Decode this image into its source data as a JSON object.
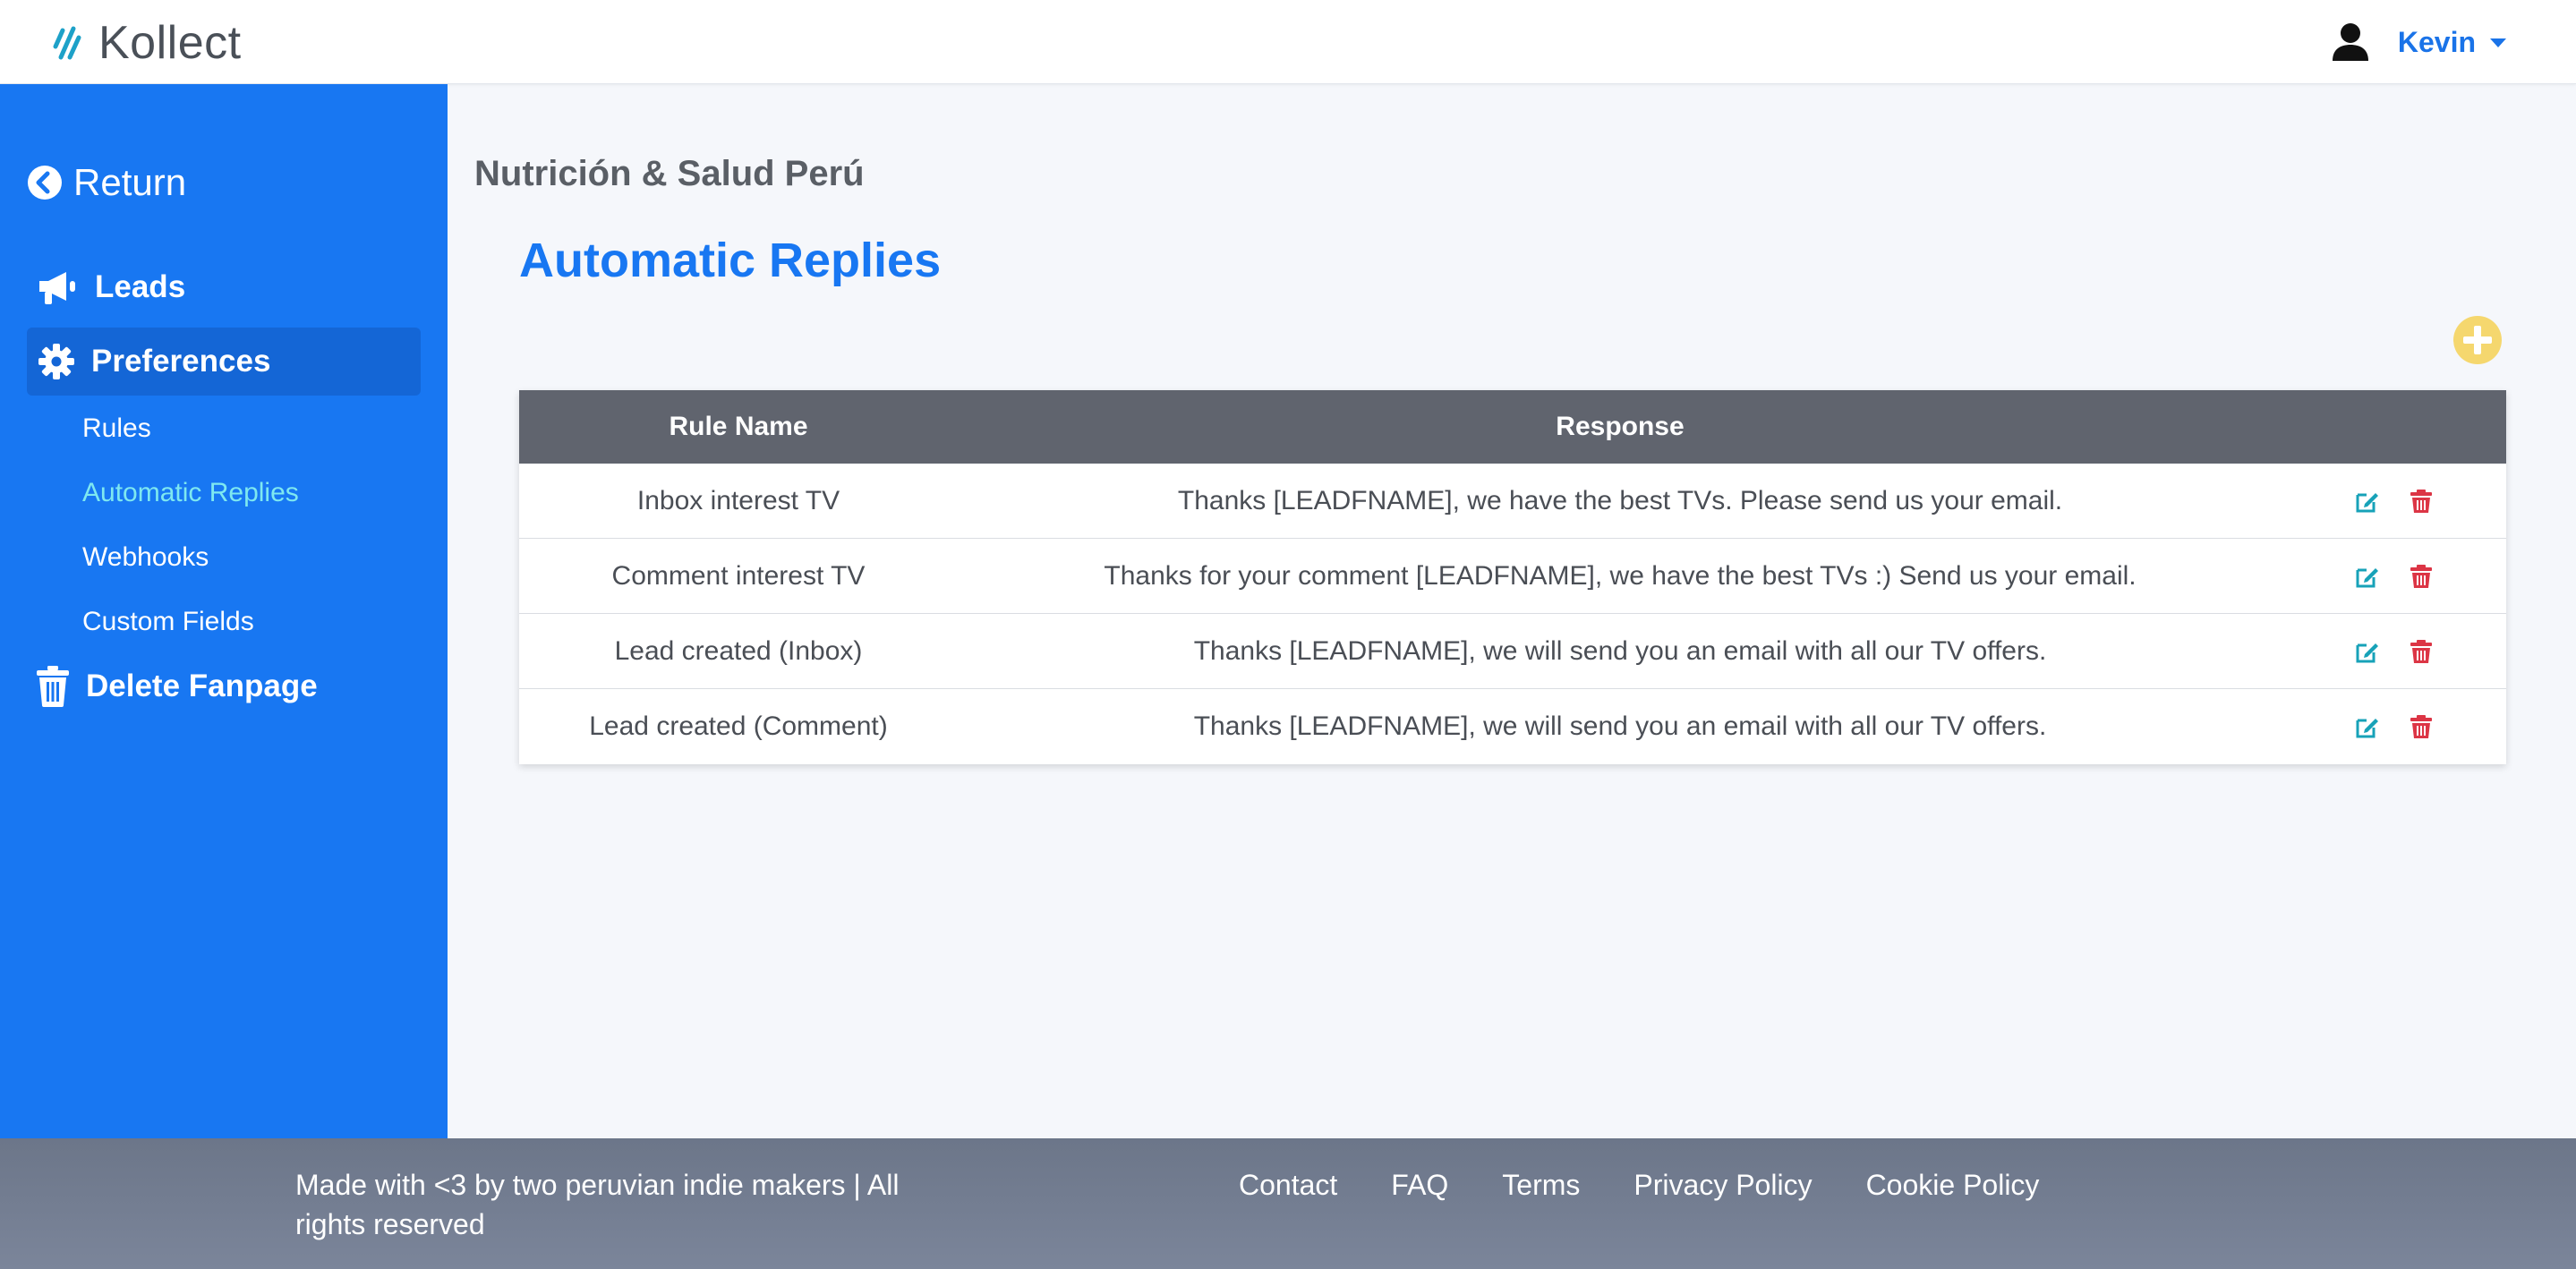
{
  "app": {
    "brand": "Kollect",
    "user": "Kevin"
  },
  "sidebar": {
    "return_label": "Return",
    "items": [
      {
        "label": "Leads",
        "icon": "megaphone-icon"
      },
      {
        "label": "Preferences",
        "icon": "gear-icon",
        "active": true
      },
      {
        "label": "Delete Fanpage",
        "icon": "trash-icon"
      }
    ],
    "subitems": [
      {
        "label": "Rules"
      },
      {
        "label": "Automatic Replies",
        "active": true
      },
      {
        "label": "Webhooks"
      },
      {
        "label": "Custom Fields"
      }
    ]
  },
  "main": {
    "page_title": "Nutrición & Salud Perú",
    "section_title": "Automatic Replies",
    "table": {
      "headers": [
        "Rule Name",
        "Response",
        ""
      ],
      "rows": [
        {
          "name": "Inbox interest TV",
          "response": "Thanks [LEADFNAME], we have the best TVs. Please send us your email."
        },
        {
          "name": "Comment interest TV",
          "response": "Thanks for your comment [LEADFNAME], we have the best TVs :) Send us your email."
        },
        {
          "name": "Lead created (Inbox)",
          "response": "Thanks [LEADFNAME], we will send you an email with all our TV offers."
        },
        {
          "name": "Lead created (Comment)",
          "response": "Thanks [LEADFNAME], we will send you an email with all our TV offers."
        }
      ]
    }
  },
  "footer": {
    "tagline": "Made with <3 by two peruvian indie makers | All rights reserved",
    "links": [
      "Contact",
      "FAQ",
      "Terms",
      "Privacy Policy",
      "Cookie Policy"
    ]
  },
  "colors": {
    "sidebar_bg": "#1877f2",
    "accent_blue": "#1877f2",
    "active_sub": "#7ee8f0",
    "table_header": "#60646e",
    "add_button": "#f5d76e",
    "edit_icon": "#17a2b8",
    "delete_icon": "#dc3545"
  }
}
